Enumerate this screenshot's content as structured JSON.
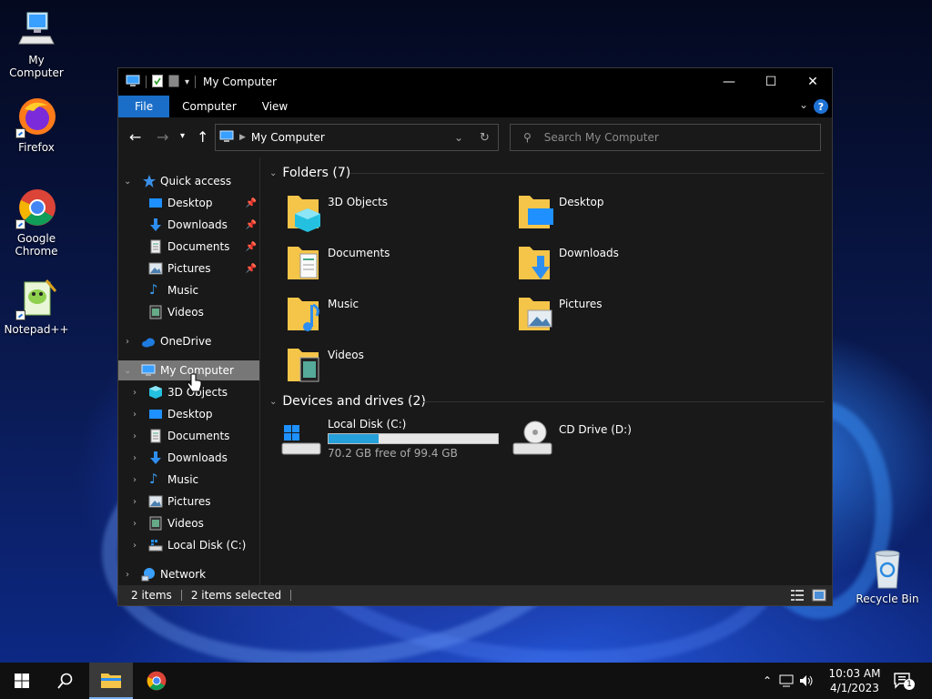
{
  "desktop": {
    "icons": [
      {
        "label": "My Computer"
      },
      {
        "label": "Firefox"
      },
      {
        "label": "Google Chrome"
      },
      {
        "label": "Notepad++"
      },
      {
        "label": "Recycle Bin"
      }
    ]
  },
  "window": {
    "title": "My Computer",
    "controls": {
      "minimize": "—",
      "maximize": "☐",
      "close": "✕"
    },
    "ribbon_tabs": [
      "File",
      "Computer",
      "View"
    ],
    "help_label": "?",
    "address": {
      "path": "My Computer"
    },
    "search": {
      "placeholder": "Search My Computer"
    },
    "nav": {
      "quick_access": "Quick access",
      "quick_items": [
        "Desktop",
        "Downloads",
        "Documents",
        "Pictures",
        "Music",
        "Videos"
      ],
      "onedrive": "OneDrive",
      "my_computer": "My Computer",
      "computer_items": [
        "3D Objects",
        "Desktop",
        "Documents",
        "Downloads",
        "Music",
        "Pictures",
        "Videos",
        "Local Disk (C:)"
      ],
      "network": "Network"
    },
    "folders_header": "Folders (7)",
    "folders": [
      "3D Objects",
      "Desktop",
      "Documents",
      "Downloads",
      "Music",
      "Pictures",
      "Videos"
    ],
    "devices_header": "Devices and drives (2)",
    "drives": [
      {
        "name": "Local Disk (C:)",
        "free_text": "70.2 GB free of 99.4 GB",
        "used_fraction": 0.294
      },
      {
        "name": "CD Drive (D:)"
      }
    ],
    "status": {
      "items": "2 items",
      "selected": "2 items selected"
    }
  },
  "taskbar": {
    "time": "10:03 AM",
    "date": "4/1/2023",
    "notification_count": "1"
  },
  "colors": {
    "accent": "#1a6ec8",
    "drive_bar": "#26a0da",
    "selection": "#777777"
  }
}
